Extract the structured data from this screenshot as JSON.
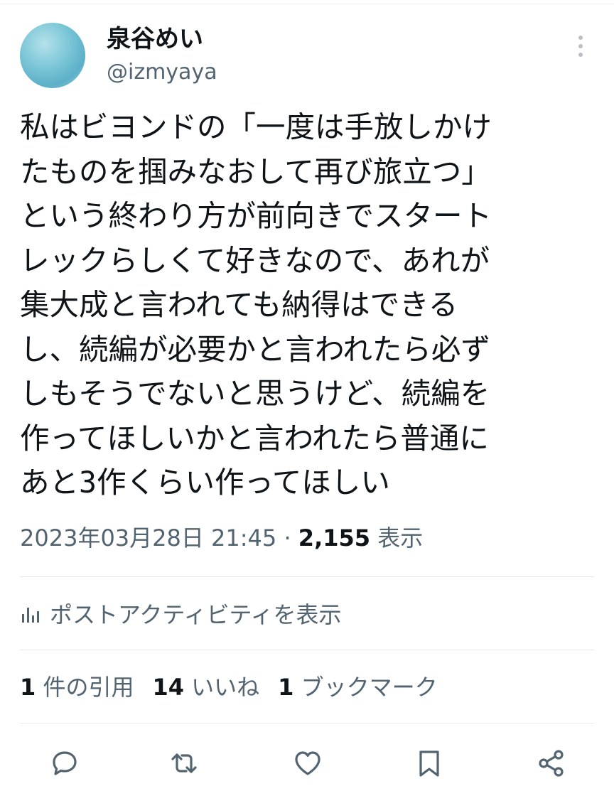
{
  "author": {
    "display_name": "泉谷めい",
    "handle": "@izmyaya"
  },
  "tweet": {
    "text_lines": [
      "私はビヨンドの「一度は手放しかけ",
      "たものを掴みなおして再び旅立つ」",
      "という終わり方が前向きでスタート",
      "レックらしくて好きなので、あれが",
      "集大成と言われても納得はできる",
      "し、続編が必要かと言われたら必ず",
      "しもそうでないと思うけど、続編を",
      "作ってほしいかと言われたら普通に",
      "あと3作くらい作ってほしい"
    ]
  },
  "meta": {
    "timestamp": "2023年03月28日 21:45",
    "separator": " · ",
    "views_count": "2,155",
    "views_label": " 表示"
  },
  "activity": {
    "label": "ポストアクティビティを表示"
  },
  "stats": {
    "quotes_count": "1",
    "quotes_label": " 件の引用",
    "likes_count": "14",
    "likes_label": " いいね",
    "bookmarks_count": "1",
    "bookmarks_label": " ブックマーク"
  },
  "icons": {
    "more": "more-vertical-icon",
    "activity": "bar-chart-icon",
    "reply": "reply-icon",
    "repost": "repost-icon",
    "like": "heart-icon",
    "bookmark": "bookmark-icon",
    "share": "share-icon"
  },
  "colors": {
    "text": "#0f1419",
    "secondary": "#536471",
    "divider": "#e7ebed"
  }
}
